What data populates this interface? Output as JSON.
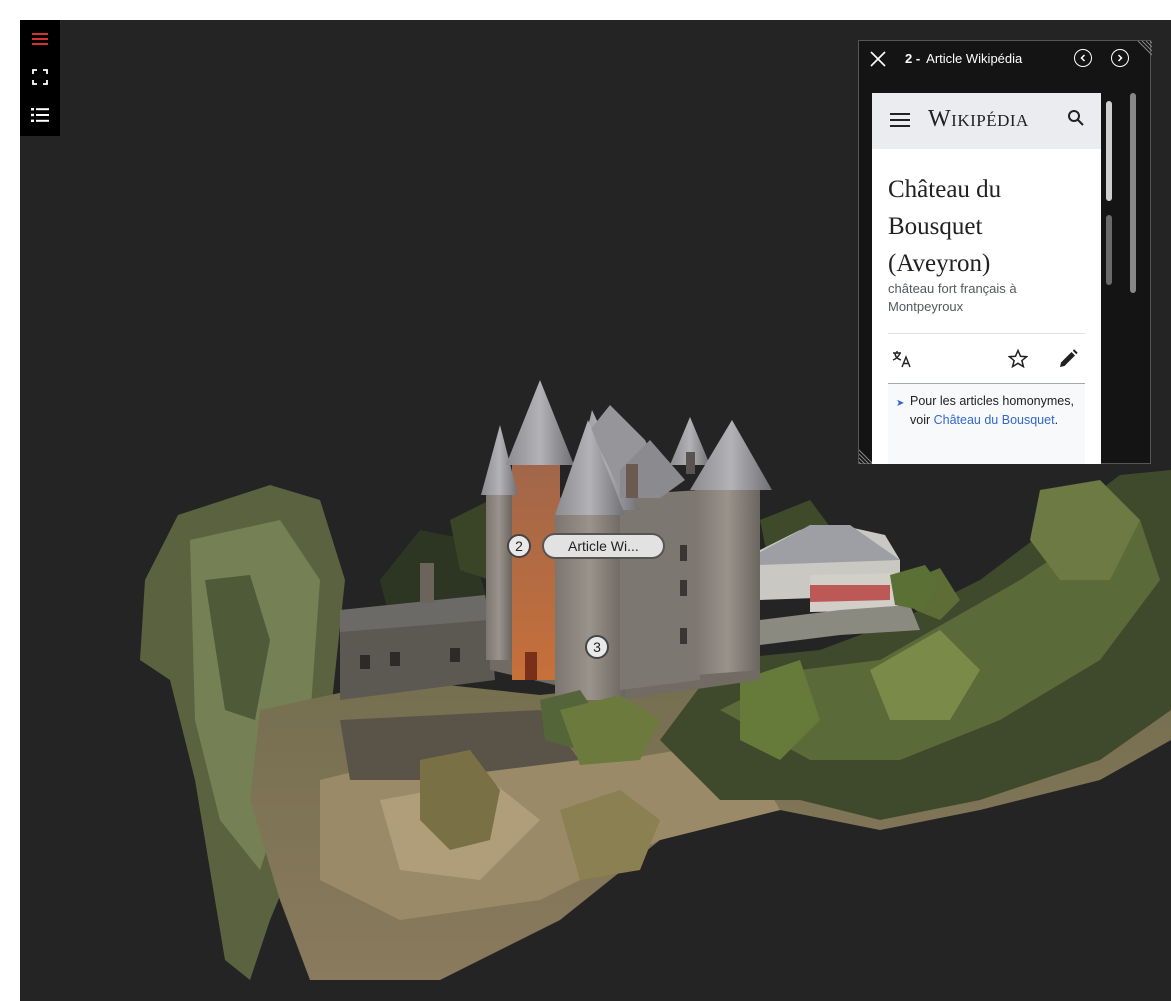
{
  "toolbar": {
    "accent_color": "#d63030",
    "items": [
      {
        "name": "menu",
        "icon": "hamburger-icon"
      },
      {
        "name": "fullscreen",
        "icon": "fullscreen-icon"
      },
      {
        "name": "list",
        "icon": "list-icon"
      }
    ]
  },
  "hotspots": [
    {
      "number": "2",
      "label": "Article Wi..."
    },
    {
      "number": "3"
    }
  ],
  "popup": {
    "number": "2 -",
    "title": "Article Wikipédia",
    "close_icon": "close-icon",
    "prev_icon": "chevron-left-circle-icon",
    "next_icon": "chevron-right-circle-icon"
  },
  "wiki": {
    "logo": "Wikipédia",
    "title": "Château du Bousquet (Aveyron)",
    "subtitle": "château fort français à Montpeyroux",
    "hatnote_text": "Pour les articles homonymes, voir ",
    "hatnote_link": "Château du Bousquet",
    "hatnote_end": ".",
    "icons": [
      "menu-icon",
      "search-icon",
      "translate-icon",
      "star-icon",
      "edit-icon"
    ]
  }
}
